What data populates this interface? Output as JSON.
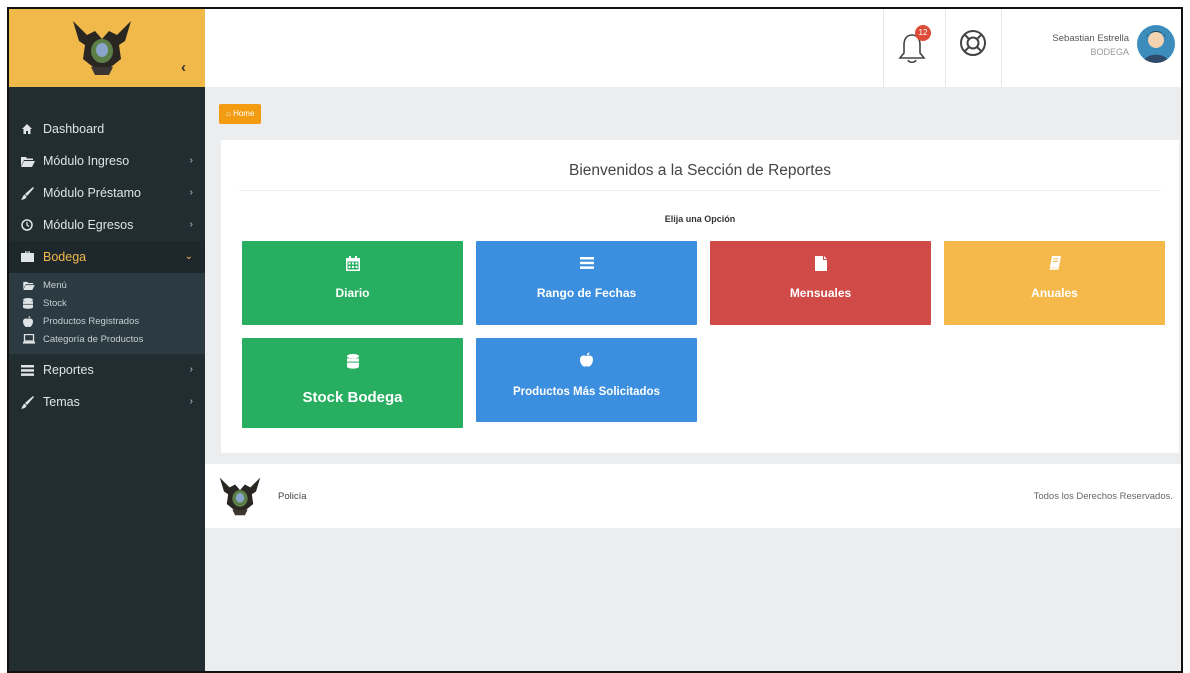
{
  "colors": {
    "brand": "#f0b94a",
    "sidebar": "#222d32",
    "green": "#27ae60",
    "blue": "#3b8fde",
    "red": "#d04a48",
    "yellow": "#f5b94b"
  },
  "sidebar": {
    "items": [
      {
        "label": "Dashboard",
        "icon": "home-icon"
      },
      {
        "label": "Módulo Ingreso",
        "icon": "folder-open-icon"
      },
      {
        "label": "Módulo Préstamo",
        "icon": "brush-icon"
      },
      {
        "label": "Módulo Egresos",
        "icon": "clock-icon"
      },
      {
        "label": "Bodega",
        "icon": "briefcase-icon"
      },
      {
        "label": "Reportes",
        "icon": "list-icon"
      },
      {
        "label": "Temas",
        "icon": "brush-icon"
      }
    ],
    "submenu": [
      {
        "label": "Menú",
        "icon": "folder-open-icon"
      },
      {
        "label": "Stock",
        "icon": "database-icon"
      },
      {
        "label": "Productos Registrados",
        "icon": "apple-icon"
      },
      {
        "label": "Categoría de Productos",
        "icon": "laptop-icon"
      }
    ]
  },
  "header": {
    "notifications": "12",
    "user_name": "Sebastian Estrella",
    "user_role": "BODEGA"
  },
  "breadcrumb": "Home",
  "panel": {
    "title": "Bienvenidos a la Sección de Reportes",
    "subtitle": "Elija una Opción"
  },
  "tiles": [
    {
      "label": "Diario",
      "icon": "calendar-icon"
    },
    {
      "label": "Rango de Fechas",
      "icon": "list-icon"
    },
    {
      "label": "Mensuales",
      "icon": "file-icon"
    },
    {
      "label": "Anuales",
      "icon": "book-icon"
    },
    {
      "label": "Stock Bodega",
      "icon": "database-icon"
    },
    {
      "label": "Productos Más Solicitados",
      "icon": "apple-icon"
    }
  ],
  "footer": {
    "name": "Policía",
    "rights": "Todos los Derechos Reservados."
  }
}
